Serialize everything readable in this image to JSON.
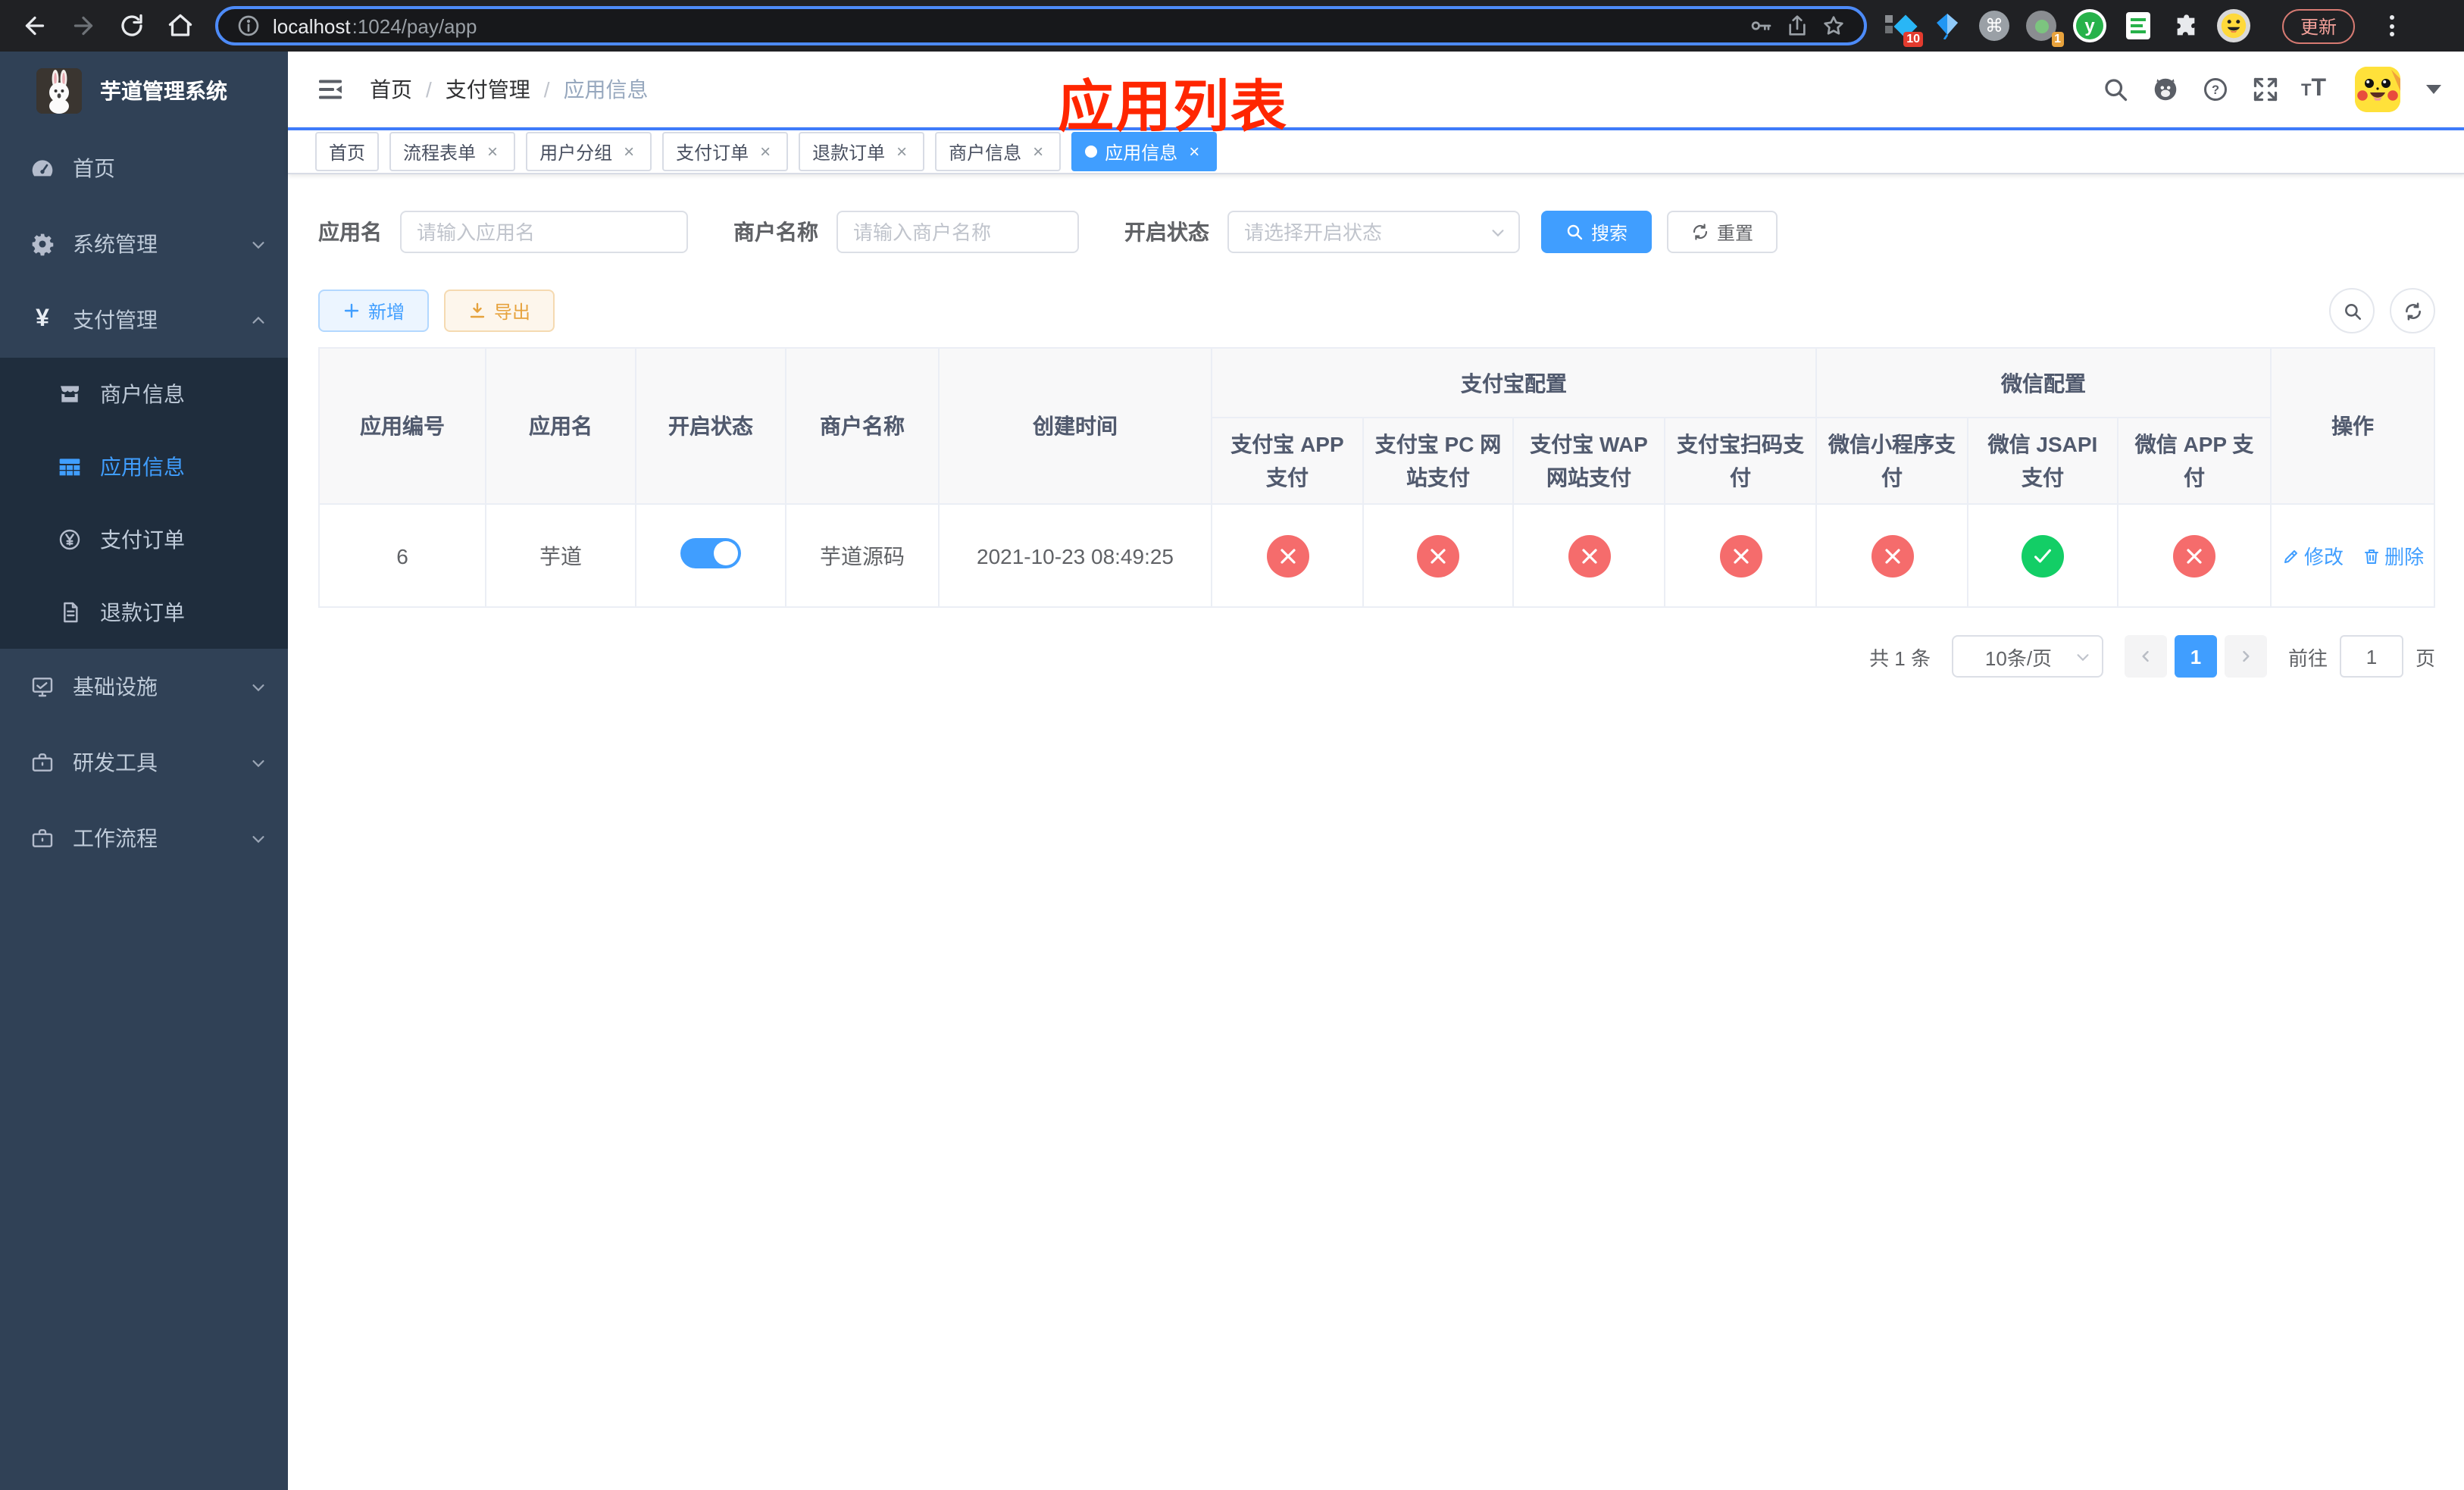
{
  "colors": {
    "accent": "#409eff",
    "success": "#13ce66",
    "danger": "#f56c6c",
    "warning": "#e6a23c",
    "sidebar_bg": "#304156",
    "submenu_bg": "#1f2d3d"
  },
  "browser": {
    "url_host": "localhost",
    "url_path": ":1024/pay/app",
    "extension_badge_10": "10",
    "extension_badge_1": "1",
    "extension_y_letter": "y",
    "update_button": "更新"
  },
  "icons": {
    "command_glyph": "⌘",
    "help_glyph": "?",
    "yen_glyph": "¥",
    "close_glyph": "×",
    "font_large": "T",
    "font_small": "T",
    "info_glyph": "i"
  },
  "annotation": {
    "title": "应用列表",
    "color": "#ff2600"
  },
  "sidebar": {
    "title": "芋道管理系统",
    "items": [
      {
        "label": "首页",
        "icon": "dashboard-icon"
      },
      {
        "label": "系统管理",
        "icon": "gear-icon",
        "chevron": "down"
      },
      {
        "label": "支付管理",
        "icon": "yen-icon",
        "chevron": "up",
        "expanded": true
      },
      {
        "label": "商户信息",
        "icon": "shop-icon",
        "sub": true
      },
      {
        "label": "应用信息",
        "icon": "grid-icon",
        "sub": true,
        "active": true
      },
      {
        "label": "支付订单",
        "icon": "yen-circle-icon",
        "sub": true
      },
      {
        "label": "退款订单",
        "icon": "document-icon",
        "sub": true
      },
      {
        "label": "基础设施",
        "icon": "monitor-icon",
        "chevron": "down"
      },
      {
        "label": "研发工具",
        "icon": "briefcase-icon",
        "chevron": "down"
      },
      {
        "label": "工作流程",
        "icon": "briefcase-icon",
        "chevron": "down"
      }
    ]
  },
  "breadcrumb": {
    "items": [
      "首页",
      "支付管理",
      "应用信息"
    ],
    "separator": "/"
  },
  "tabs": [
    {
      "label": "首页",
      "closable": false
    },
    {
      "label": "流程表单",
      "closable": true
    },
    {
      "label": "用户分组",
      "closable": true
    },
    {
      "label": "支付订单",
      "closable": true
    },
    {
      "label": "退款订单",
      "closable": true
    },
    {
      "label": "商户信息",
      "closable": true
    },
    {
      "label": "应用信息",
      "closable": true,
      "active": true
    }
  ],
  "search": {
    "app_name_label": "应用名",
    "app_name_placeholder": "请输入应用名",
    "merchant_label": "商户名称",
    "merchant_placeholder": "请输入商户名称",
    "status_label": "开启状态",
    "status_placeholder": "请选择开启状态",
    "search_button": "搜索",
    "reset_button": "重置"
  },
  "toolbar": {
    "add_button": "新增",
    "export_button": "导出"
  },
  "table": {
    "columns": [
      "应用编号",
      "应用名",
      "开启状态",
      "商户名称",
      "创建时间"
    ],
    "groups": [
      {
        "label": "支付宝配置",
        "children": [
          "支付宝 APP 支付",
          "支付宝 PC 网站支付",
          "支付宝 WAP 网站支付",
          "支付宝扫码支付"
        ]
      },
      {
        "label": "微信配置",
        "children": [
          "微信小程序支付",
          "微信 JSAPI 支付",
          "微信 APP 支付"
        ]
      }
    ],
    "ops_column": "操作",
    "row": {
      "id": "6",
      "name": "芋道",
      "enabled": true,
      "merchant": "芋道源码",
      "created": "2021-10-23 08:49:25",
      "alipay_app": "no",
      "alipay_pc": "no",
      "alipay_wap": "no",
      "alipay_qr": "no",
      "wx_lite": "no",
      "wx_jsapi": "yes",
      "wx_app": "no",
      "edit_label": "修改",
      "delete_label": "删除"
    }
  },
  "pagination": {
    "total": "共 1 条",
    "page_size": "10条/页",
    "current_page": "1",
    "jump_prefix": "前往",
    "jump_value": "1",
    "jump_suffix": "页"
  }
}
